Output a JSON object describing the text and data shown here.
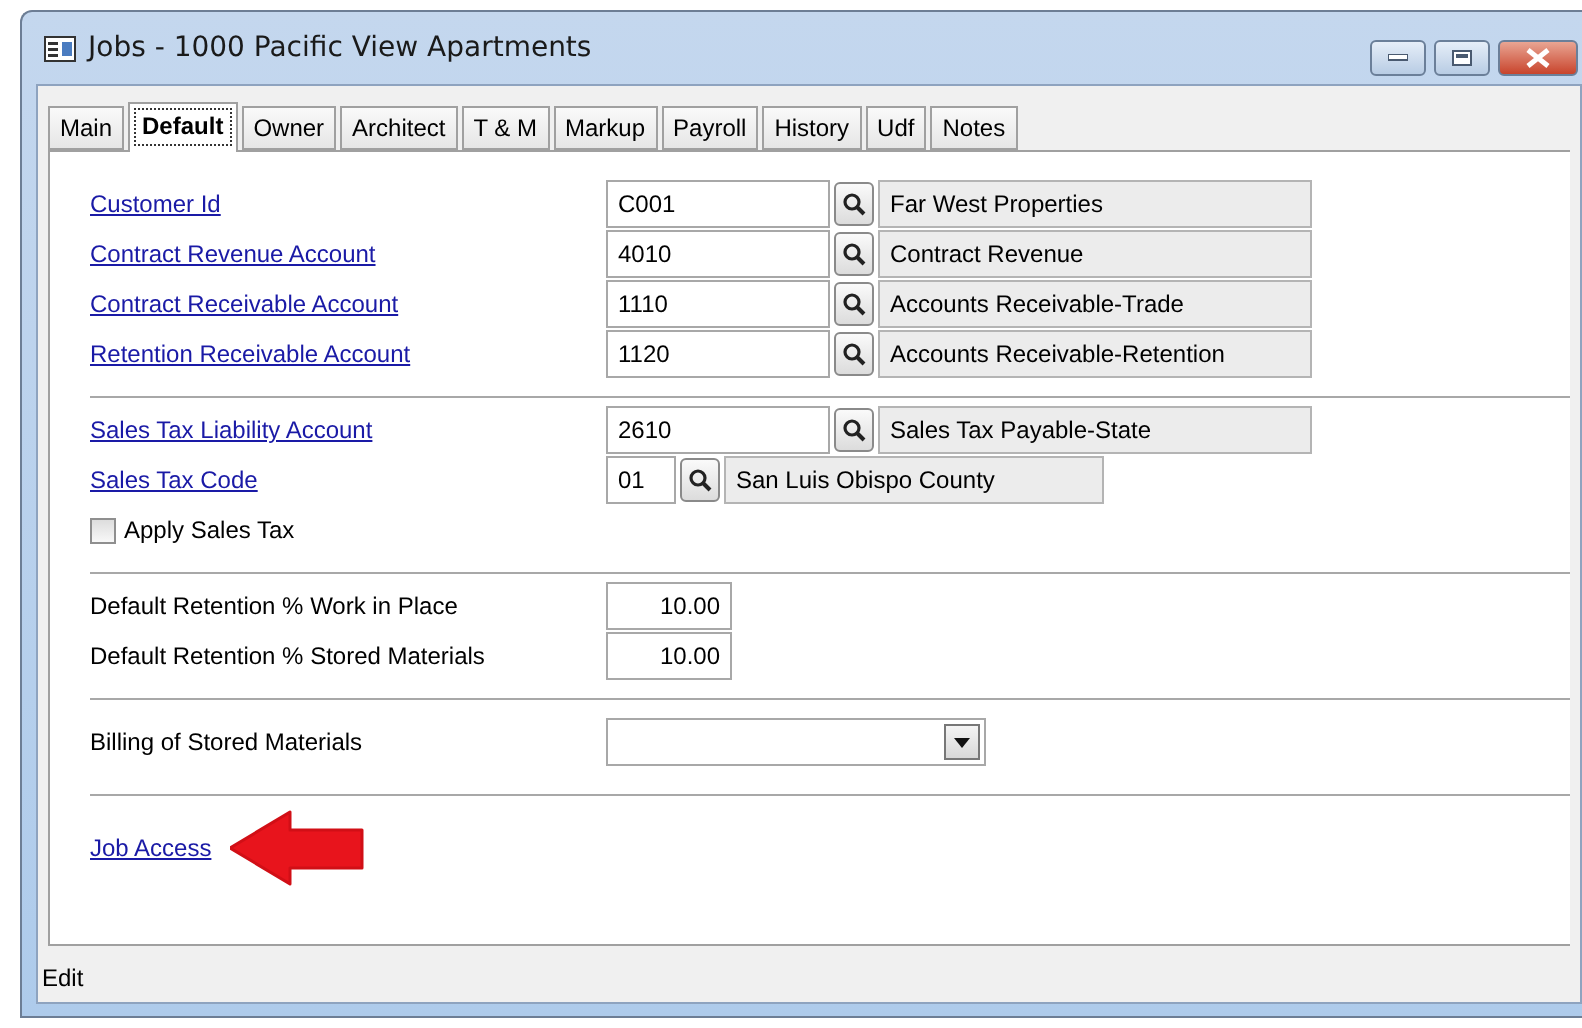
{
  "window": {
    "title": "Jobs - 1000  Pacific View Apartments"
  },
  "tabs": [
    {
      "label": "Main",
      "selected": false
    },
    {
      "label": "Default",
      "selected": true
    },
    {
      "label": "Owner",
      "selected": false
    },
    {
      "label": "Architect",
      "selected": false
    },
    {
      "label": "T & M",
      "selected": false
    },
    {
      "label": "Markup",
      "selected": false
    },
    {
      "label": "Payroll",
      "selected": false
    },
    {
      "label": "History",
      "selected": false
    },
    {
      "label": "Udf",
      "selected": false
    },
    {
      "label": "Notes",
      "selected": false
    }
  ],
  "sections": [
    {
      "rows": [
        {
          "kind": "lookup",
          "label": "Customer Id",
          "value": "C001",
          "description": "Far West Properties"
        },
        {
          "kind": "lookup",
          "label": "Contract Revenue Account",
          "value": "4010",
          "description": "Contract Revenue"
        },
        {
          "kind": "lookup",
          "label": "Contract Receivable Account",
          "value": "1110",
          "description": "Accounts Receivable-Trade"
        },
        {
          "kind": "lookup",
          "label": "Retention Receivable Account",
          "value": "1120",
          "description": "Accounts Receivable-Retention"
        }
      ]
    },
    {
      "rows": [
        {
          "kind": "lookup",
          "label": "Sales Tax Liability Account",
          "value": "2610",
          "description": "Sales Tax Payable-State"
        },
        {
          "kind": "short-lookup",
          "label": "Sales Tax Code",
          "value": "01",
          "description": "San Luis Obispo County"
        },
        {
          "kind": "checkbox",
          "label": "Apply Sales Tax",
          "checked": false
        }
      ]
    },
    {
      "rows": [
        {
          "kind": "number",
          "label": "Default Retention % Work in Place",
          "value": "10.00"
        },
        {
          "kind": "number",
          "label": "Default Retention % Stored Materials",
          "value": "10.00"
        }
      ]
    },
    {
      "rows": [
        {
          "kind": "dropdown",
          "label": "Billing of Stored Materials"
        }
      ]
    },
    {
      "rows": [
        {
          "kind": "link",
          "label": "Job Access"
        }
      ]
    }
  ],
  "status_bar": "Edit"
}
